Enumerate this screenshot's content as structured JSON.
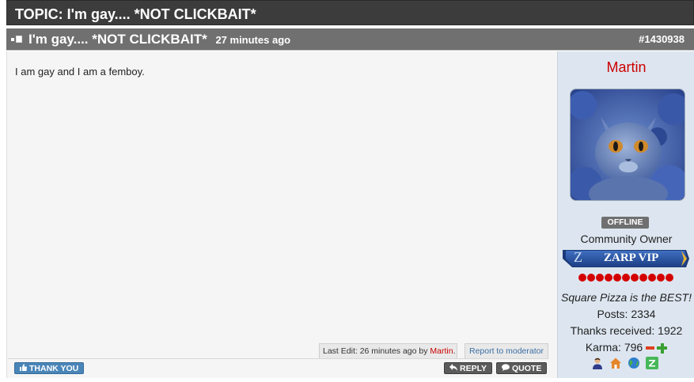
{
  "topic": {
    "label": "TOPIC: I'm gay.... *NOT CLICKBAIT*"
  },
  "post": {
    "title": "I'm gay.... *NOT CLICKBAIT*",
    "time": "27 minutes ago",
    "number": "#1430938",
    "body": "I am gay and I am a femboy.",
    "last_edit_prefix": "Last Edit: 26 minutes ago by ",
    "last_edit_user": "Martin",
    "last_edit_suffix": ".",
    "report_label": "Report to moderator"
  },
  "buttons": {
    "thank_you": "THANK YOU",
    "reply": "REPLY",
    "quote": "QUOTE"
  },
  "author": {
    "name": "Martin",
    "status": "OFFLINE",
    "rank": "Community Owner",
    "badge_letter": "Z",
    "badge_label": "ZARP VIP",
    "reputation_dots": 11,
    "signature": "Square Pizza is the BEST!",
    "posts": "Posts: 2334",
    "thanks": "Thanks received: 1922",
    "karma": "Karma: 796"
  },
  "colors": {
    "username": "#cc0000",
    "header_bg": "#707070",
    "topic_bg": "#3c3c3c",
    "sidebar_bg": "#dde6f0",
    "thanks_btn": "#4a85b8"
  },
  "icons": [
    "user-profile-icon",
    "home-icon",
    "globe-icon",
    "zarp-icon"
  ]
}
